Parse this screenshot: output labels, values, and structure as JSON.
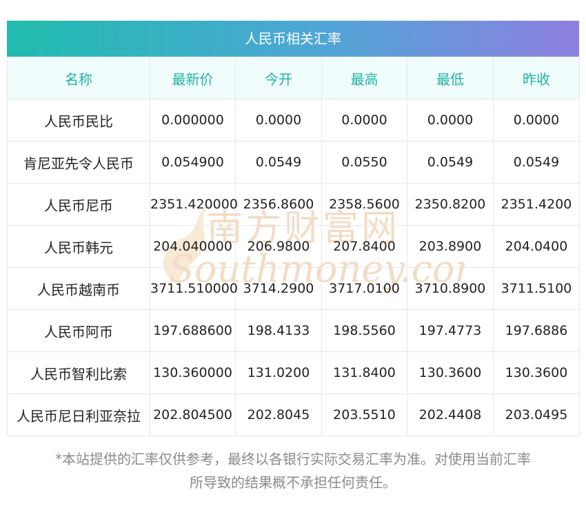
{
  "title": "人民币相关汇率",
  "columns": [
    "名称",
    "最新价",
    "今开",
    "最高",
    "最低",
    "昨收"
  ],
  "rows": [
    [
      "人民币民比",
      "0.000000",
      "0.0000",
      "0.0000",
      "0.0000",
      "0.0000"
    ],
    [
      "肯尼亚先令人民币",
      "0.054900",
      "0.0549",
      "0.0550",
      "0.0549",
      "0.0549"
    ],
    [
      "人民币尼币",
      "2351.420000",
      "2356.8600",
      "2358.5600",
      "2350.8200",
      "2351.4200"
    ],
    [
      "人民币韩元",
      "204.040000",
      "206.9800",
      "207.8400",
      "203.8900",
      "204.0400"
    ],
    [
      "人民币越南币",
      "3711.510000",
      "3714.2900",
      "3717.0100",
      "3710.8900",
      "3711.5100"
    ],
    [
      "人民币阿币",
      "197.688600",
      "198.4133",
      "198.5560",
      "197.4773",
      "197.6886"
    ],
    [
      "人民币智利比索",
      "130.360000",
      "131.0200",
      "131.8400",
      "130.3600",
      "130.3600"
    ],
    [
      "人民币尼日利亚奈拉",
      "202.804500",
      "202.8045",
      "203.5510",
      "202.4408",
      "203.0495"
    ]
  ],
  "watermark": {
    "cn": "南方财富网",
    "en": "Southmoney.com"
  },
  "footer": {
    "line1": "*本站提供的汇率仅供参考，最终以各银行实际交易汇率为准。对使用当前汇率",
    "line2": "所导致的结果概不承担任何责任。"
  },
  "colors": {
    "header_text": "#20b2a6",
    "header_bg": "#f0fdfc",
    "gradient_start": "#20bcae",
    "gradient_end": "#8e7fe0",
    "watermark": "#f5d9b8"
  }
}
